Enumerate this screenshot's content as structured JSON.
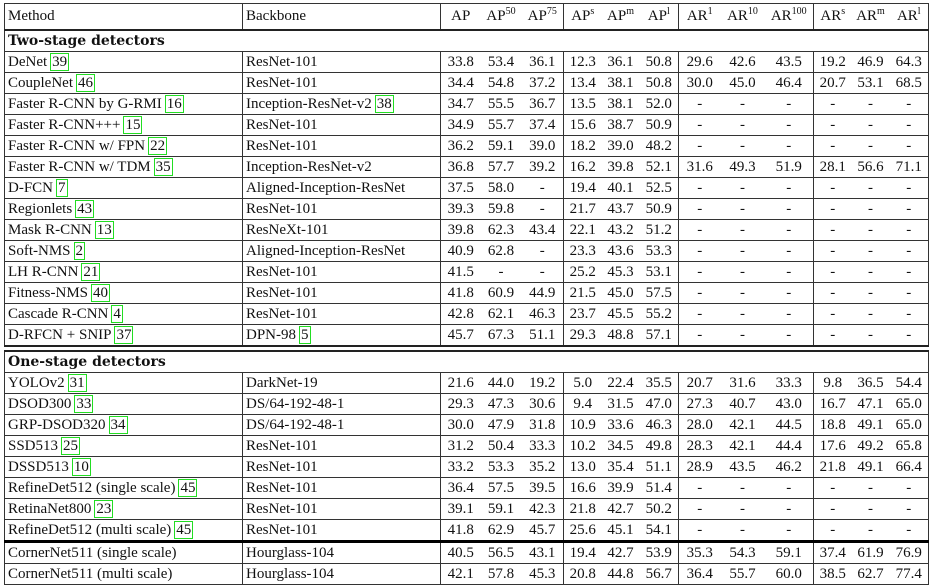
{
  "columns": {
    "method": "Method",
    "backbone": "Backbone",
    "metrics": [
      {
        "base": "AP",
        "sup": ""
      },
      {
        "base": "AP",
        "sup": "50"
      },
      {
        "base": "AP",
        "sup": "75"
      },
      {
        "base": "AP",
        "sup": "s"
      },
      {
        "base": "AP",
        "sup": "m"
      },
      {
        "base": "AP",
        "sup": "l"
      },
      {
        "base": "AR",
        "sup": "1"
      },
      {
        "base": "AR",
        "sup": "10"
      },
      {
        "base": "AR",
        "sup": "100"
      },
      {
        "base": "AR",
        "sup": "s"
      },
      {
        "base": "AR",
        "sup": "m"
      },
      {
        "base": "AR",
        "sup": "l"
      }
    ]
  },
  "sections": [
    {
      "title": "Two-stage detectors",
      "rows": [
        {
          "method": "DeNet",
          "ref": "39",
          "backbone": "ResNet-101",
          "bref": "",
          "values": [
            "33.8",
            "53.4",
            "36.1",
            "12.3",
            "36.1",
            "50.8",
            "29.6",
            "42.6",
            "43.5",
            "19.2",
            "46.9",
            "64.3"
          ]
        },
        {
          "method": "CoupleNet",
          "ref": "46",
          "backbone": "ResNet-101",
          "bref": "",
          "values": [
            "34.4",
            "54.8",
            "37.2",
            "13.4",
            "38.1",
            "50.8",
            "30.0",
            "45.0",
            "46.4",
            "20.7",
            "53.1",
            "68.5"
          ]
        },
        {
          "method": "Faster R-CNN by G-RMI",
          "ref": "16",
          "backbone": "Inception-ResNet-v2",
          "bref": "38",
          "values": [
            "34.7",
            "55.5",
            "36.7",
            "13.5",
            "38.1",
            "52.0",
            "-",
            "-",
            "-",
            "-",
            "-",
            "-"
          ]
        },
        {
          "method": "Faster R-CNN+++",
          "ref": "15",
          "backbone": "ResNet-101",
          "bref": "",
          "values": [
            "34.9",
            "55.7",
            "37.4",
            "15.6",
            "38.7",
            "50.9",
            "-",
            "-",
            "-",
            "-",
            "-",
            "-"
          ]
        },
        {
          "method": "Faster R-CNN w/ FPN",
          "ref": "22",
          "backbone": "ResNet-101",
          "bref": "",
          "values": [
            "36.2",
            "59.1",
            "39.0",
            "18.2",
            "39.0",
            "48.2",
            "-",
            "-",
            "-",
            "-",
            "-",
            "-"
          ]
        },
        {
          "method": "Faster R-CNN w/ TDM",
          "ref": "35",
          "backbone": "Inception-ResNet-v2",
          "bref": "",
          "values": [
            "36.8",
            "57.7",
            "39.2",
            "16.2",
            "39.8",
            "52.1",
            "31.6",
            "49.3",
            "51.9",
            "28.1",
            "56.6",
            "71.1"
          ]
        },
        {
          "method": "D-FCN",
          "ref": "7",
          "backbone": "Aligned-Inception-ResNet",
          "bref": "",
          "values": [
            "37.5",
            "58.0",
            "-",
            "19.4",
            "40.1",
            "52.5",
            "-",
            "-",
            "-",
            "-",
            "-",
            "-"
          ]
        },
        {
          "method": "Regionlets",
          "ref": "43",
          "backbone": "ResNet-101",
          "bref": "",
          "values": [
            "39.3",
            "59.8",
            "-",
            "21.7",
            "43.7",
            "50.9",
            "-",
            "-",
            "-",
            "-",
            "-",
            "-"
          ]
        },
        {
          "method": "Mask R-CNN",
          "ref": "13",
          "backbone": "ResNeXt-101",
          "bref": "",
          "values": [
            "39.8",
            "62.3",
            "43.4",
            "22.1",
            "43.2",
            "51.2",
            "-",
            "-",
            "-",
            "-",
            "-",
            "-"
          ]
        },
        {
          "method": "Soft-NMS",
          "ref": "2",
          "backbone": "Aligned-Inception-ResNet",
          "bref": "",
          "values": [
            "40.9",
            "62.8",
            "-",
            "23.3",
            "43.6",
            "53.3",
            "-",
            "-",
            "-",
            "-",
            "-",
            "-"
          ]
        },
        {
          "method": "LH R-CNN",
          "ref": "21",
          "backbone": "ResNet-101",
          "bref": "",
          "values": [
            "41.5",
            "-",
            "-",
            "25.2",
            "45.3",
            "53.1",
            "-",
            "-",
            "-",
            "-",
            "-",
            "-"
          ]
        },
        {
          "method": "Fitness-NMS",
          "ref": "40",
          "backbone": "ResNet-101",
          "bref": "",
          "values": [
            "41.8",
            "60.9",
            "44.9",
            "21.5",
            "45.0",
            "57.5",
            "-",
            "-",
            "-",
            "-",
            "-",
            "-"
          ]
        },
        {
          "method": "Cascade R-CNN",
          "ref": "4",
          "backbone": "ResNet-101",
          "bref": "",
          "values": [
            "42.8",
            "62.1",
            "46.3",
            "23.7",
            "45.5",
            "55.2",
            "-",
            "-",
            "-",
            "-",
            "-",
            "-"
          ]
        },
        {
          "method": "D-RFCN + SNIP",
          "ref": "37",
          "backbone": "DPN-98",
          "bref": "5",
          "values": [
            "45.7",
            "67.3",
            "51.1",
            "29.3",
            "48.8",
            "57.1",
            "-",
            "-",
            "-",
            "-",
            "-",
            "-"
          ]
        }
      ]
    },
    {
      "title": "One-stage detectors",
      "rows": [
        {
          "method": "YOLOv2",
          "ref": "31",
          "backbone": "DarkNet-19",
          "bref": "",
          "values": [
            "21.6",
            "44.0",
            "19.2",
            "5.0",
            "22.4",
            "35.5",
            "20.7",
            "31.6",
            "33.3",
            "9.8",
            "36.5",
            "54.4"
          ]
        },
        {
          "method": "DSOD300",
          "ref": "33",
          "backbone": "DS/64-192-48-1",
          "bref": "",
          "values": [
            "29.3",
            "47.3",
            "30.6",
            "9.4",
            "31.5",
            "47.0",
            "27.3",
            "40.7",
            "43.0",
            "16.7",
            "47.1",
            "65.0"
          ]
        },
        {
          "method": "GRP-DSOD320",
          "ref": "34",
          "backbone": "DS/64-192-48-1",
          "bref": "",
          "values": [
            "30.0",
            "47.9",
            "31.8",
            "10.9",
            "33.6",
            "46.3",
            "28.0",
            "42.1",
            "44.5",
            "18.8",
            "49.1",
            "65.0"
          ]
        },
        {
          "method": "SSD513",
          "ref": "25",
          "backbone": "ResNet-101",
          "bref": "",
          "values": [
            "31.2",
            "50.4",
            "33.3",
            "10.2",
            "34.5",
            "49.8",
            "28.3",
            "42.1",
            "44.4",
            "17.6",
            "49.2",
            "65.8"
          ]
        },
        {
          "method": "DSSD513",
          "ref": "10",
          "backbone": "ResNet-101",
          "bref": "",
          "values": [
            "33.2",
            "53.3",
            "35.2",
            "13.0",
            "35.4",
            "51.1",
            "28.9",
            "43.5",
            "46.2",
            "21.8",
            "49.1",
            "66.4"
          ]
        },
        {
          "method": "RefineDet512 (single scale)",
          "ref": "45",
          "backbone": "ResNet-101",
          "bref": "",
          "values": [
            "36.4",
            "57.5",
            "39.5",
            "16.6",
            "39.9",
            "51.4",
            "-",
            "-",
            "-",
            "-",
            "-",
            "-"
          ]
        },
        {
          "method": "RetinaNet800",
          "ref": "23",
          "backbone": "ResNet-101",
          "bref": "",
          "values": [
            "39.1",
            "59.1",
            "42.3",
            "21.8",
            "42.7",
            "50.2",
            "-",
            "-",
            "-",
            "-",
            "-",
            "-"
          ]
        },
        {
          "method": "RefineDet512 (multi scale)",
          "ref": "45",
          "backbone": "ResNet-101",
          "bref": "",
          "values": [
            "41.8",
            "62.9",
            "45.7",
            "25.6",
            "45.1",
            "54.1",
            "-",
            "-",
            "-",
            "-",
            "-",
            "-"
          ]
        }
      ]
    }
  ],
  "ours": [
    {
      "method": "CornerNet511 (single scale)",
      "ref": "",
      "backbone": "Hourglass-104",
      "bref": "",
      "values": [
        "40.5",
        "56.5",
        "43.1",
        "19.4",
        "42.7",
        "53.9",
        "35.3",
        "54.3",
        "59.1",
        "37.4",
        "61.9",
        "76.9"
      ]
    },
    {
      "method": "CornerNet511 (multi scale)",
      "ref": "",
      "backbone": "Hourglass-104",
      "bref": "",
      "values": [
        "42.1",
        "57.8",
        "45.3",
        "20.8",
        "44.8",
        "56.7",
        "36.4",
        "55.7",
        "60.0",
        "38.5",
        "62.7",
        "77.4"
      ]
    }
  ],
  "colors": {
    "citation_box": "#22dd22",
    "rule": "#333333"
  }
}
